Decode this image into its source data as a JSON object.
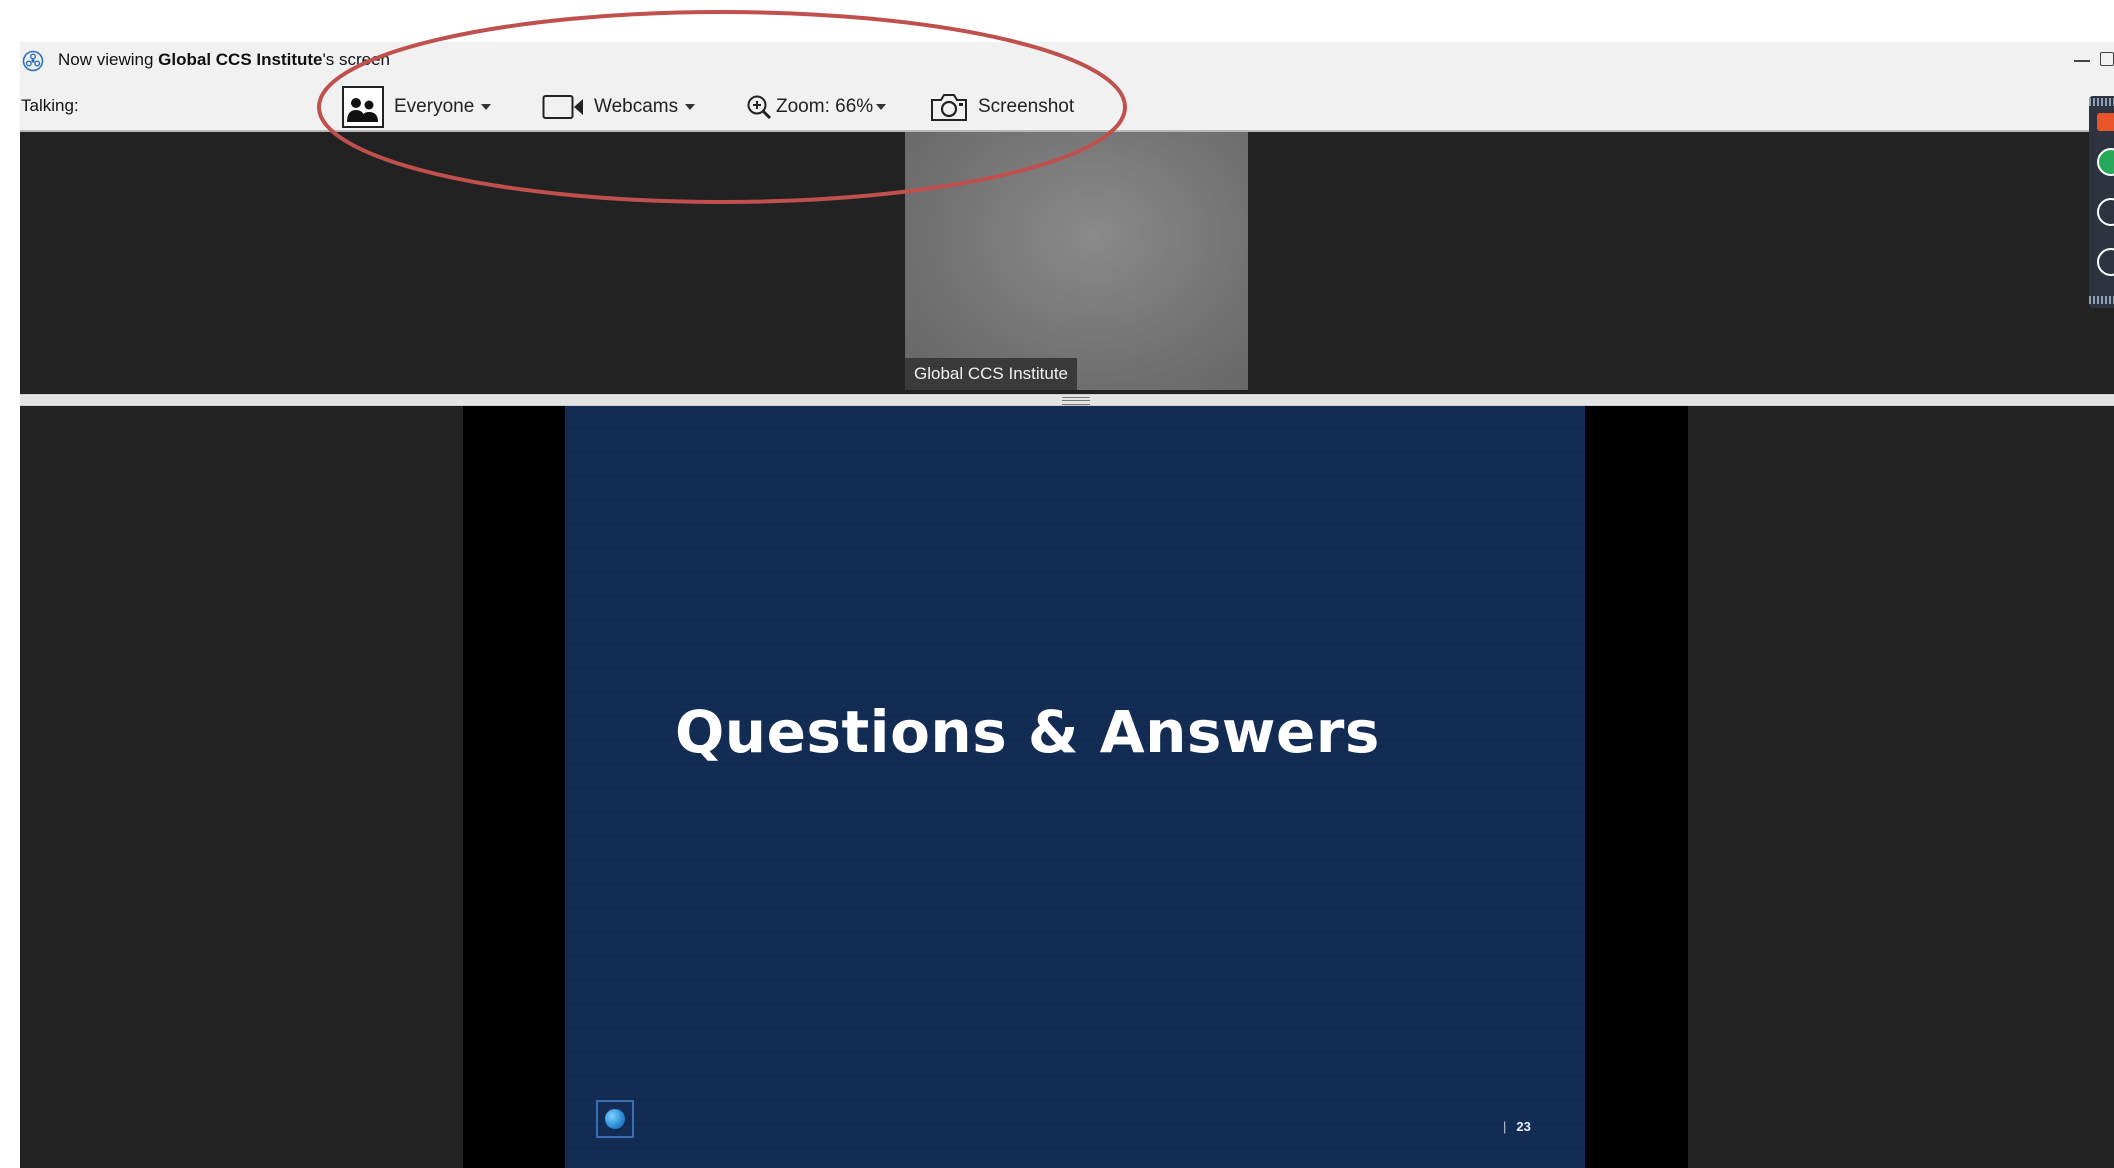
{
  "titlebar": {
    "prefix": "Now viewing ",
    "presenter": "Global CCS Institute",
    "suffix": "'s screen"
  },
  "toolbar": {
    "talking_label": "Talking:",
    "audience_label": "Everyone",
    "webcams_label": "Webcams",
    "zoom_label": "Zoom: 66%",
    "screenshot_label": "Screenshot"
  },
  "webcam": {
    "name": "Global CCS Institute"
  },
  "slide": {
    "title": "Questions & Answers",
    "bar": "|",
    "page_number": "23"
  },
  "colors": {
    "annotation": "#c0504d",
    "slide_bg": "#112b52",
    "panel_bg": "#222222"
  }
}
